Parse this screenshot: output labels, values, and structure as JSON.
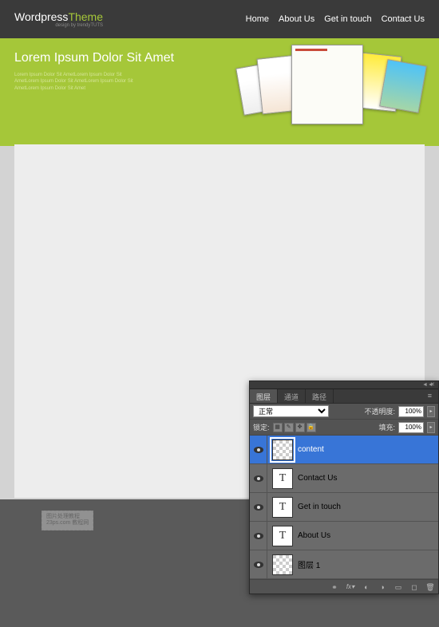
{
  "header": {
    "logo_word1": "Wordpress",
    "logo_word2": "Theme",
    "logo_sub": "design by trendyTUTS",
    "nav": [
      "Home",
      "About Us",
      "Get in touch",
      "Contact Us"
    ]
  },
  "hero": {
    "title": "Lorem Ipsum Dolor Sit Amet",
    "body": "Lorem Ipsum Dolor Sit AmetLorem Ipsum Dolor Sit\nAmetLorem Ipsum Dolor Sit AmetLorem Ipsum Dolor Sit\nAmetLorem Ipsum Dolor Sit Amet"
  },
  "watermark": {
    "line1": "图片处理教程",
    "line2": "23ps.com 教程网"
  },
  "ps_panel": {
    "tabs": [
      "图层",
      "通道",
      "路径"
    ],
    "blend_mode": "正常",
    "opacity_label": "不透明度:",
    "opacity_value": "100%",
    "lock_label": "锁定:",
    "fill_label": "填充:",
    "fill_value": "100%",
    "layers": [
      {
        "name": "content",
        "type": "checker",
        "selected": true
      },
      {
        "name": "Contact Us",
        "type": "text",
        "selected": false
      },
      {
        "name": "Get in touch",
        "type": "text",
        "selected": false
      },
      {
        "name": "About Us",
        "type": "text",
        "selected": false
      },
      {
        "name": "图层 1",
        "type": "checker",
        "selected": false
      }
    ],
    "footer_icons": [
      "link-icon",
      "fx-icon",
      "mask-icon",
      "adjust-icon",
      "group-icon",
      "new-icon",
      "trash-icon"
    ]
  }
}
